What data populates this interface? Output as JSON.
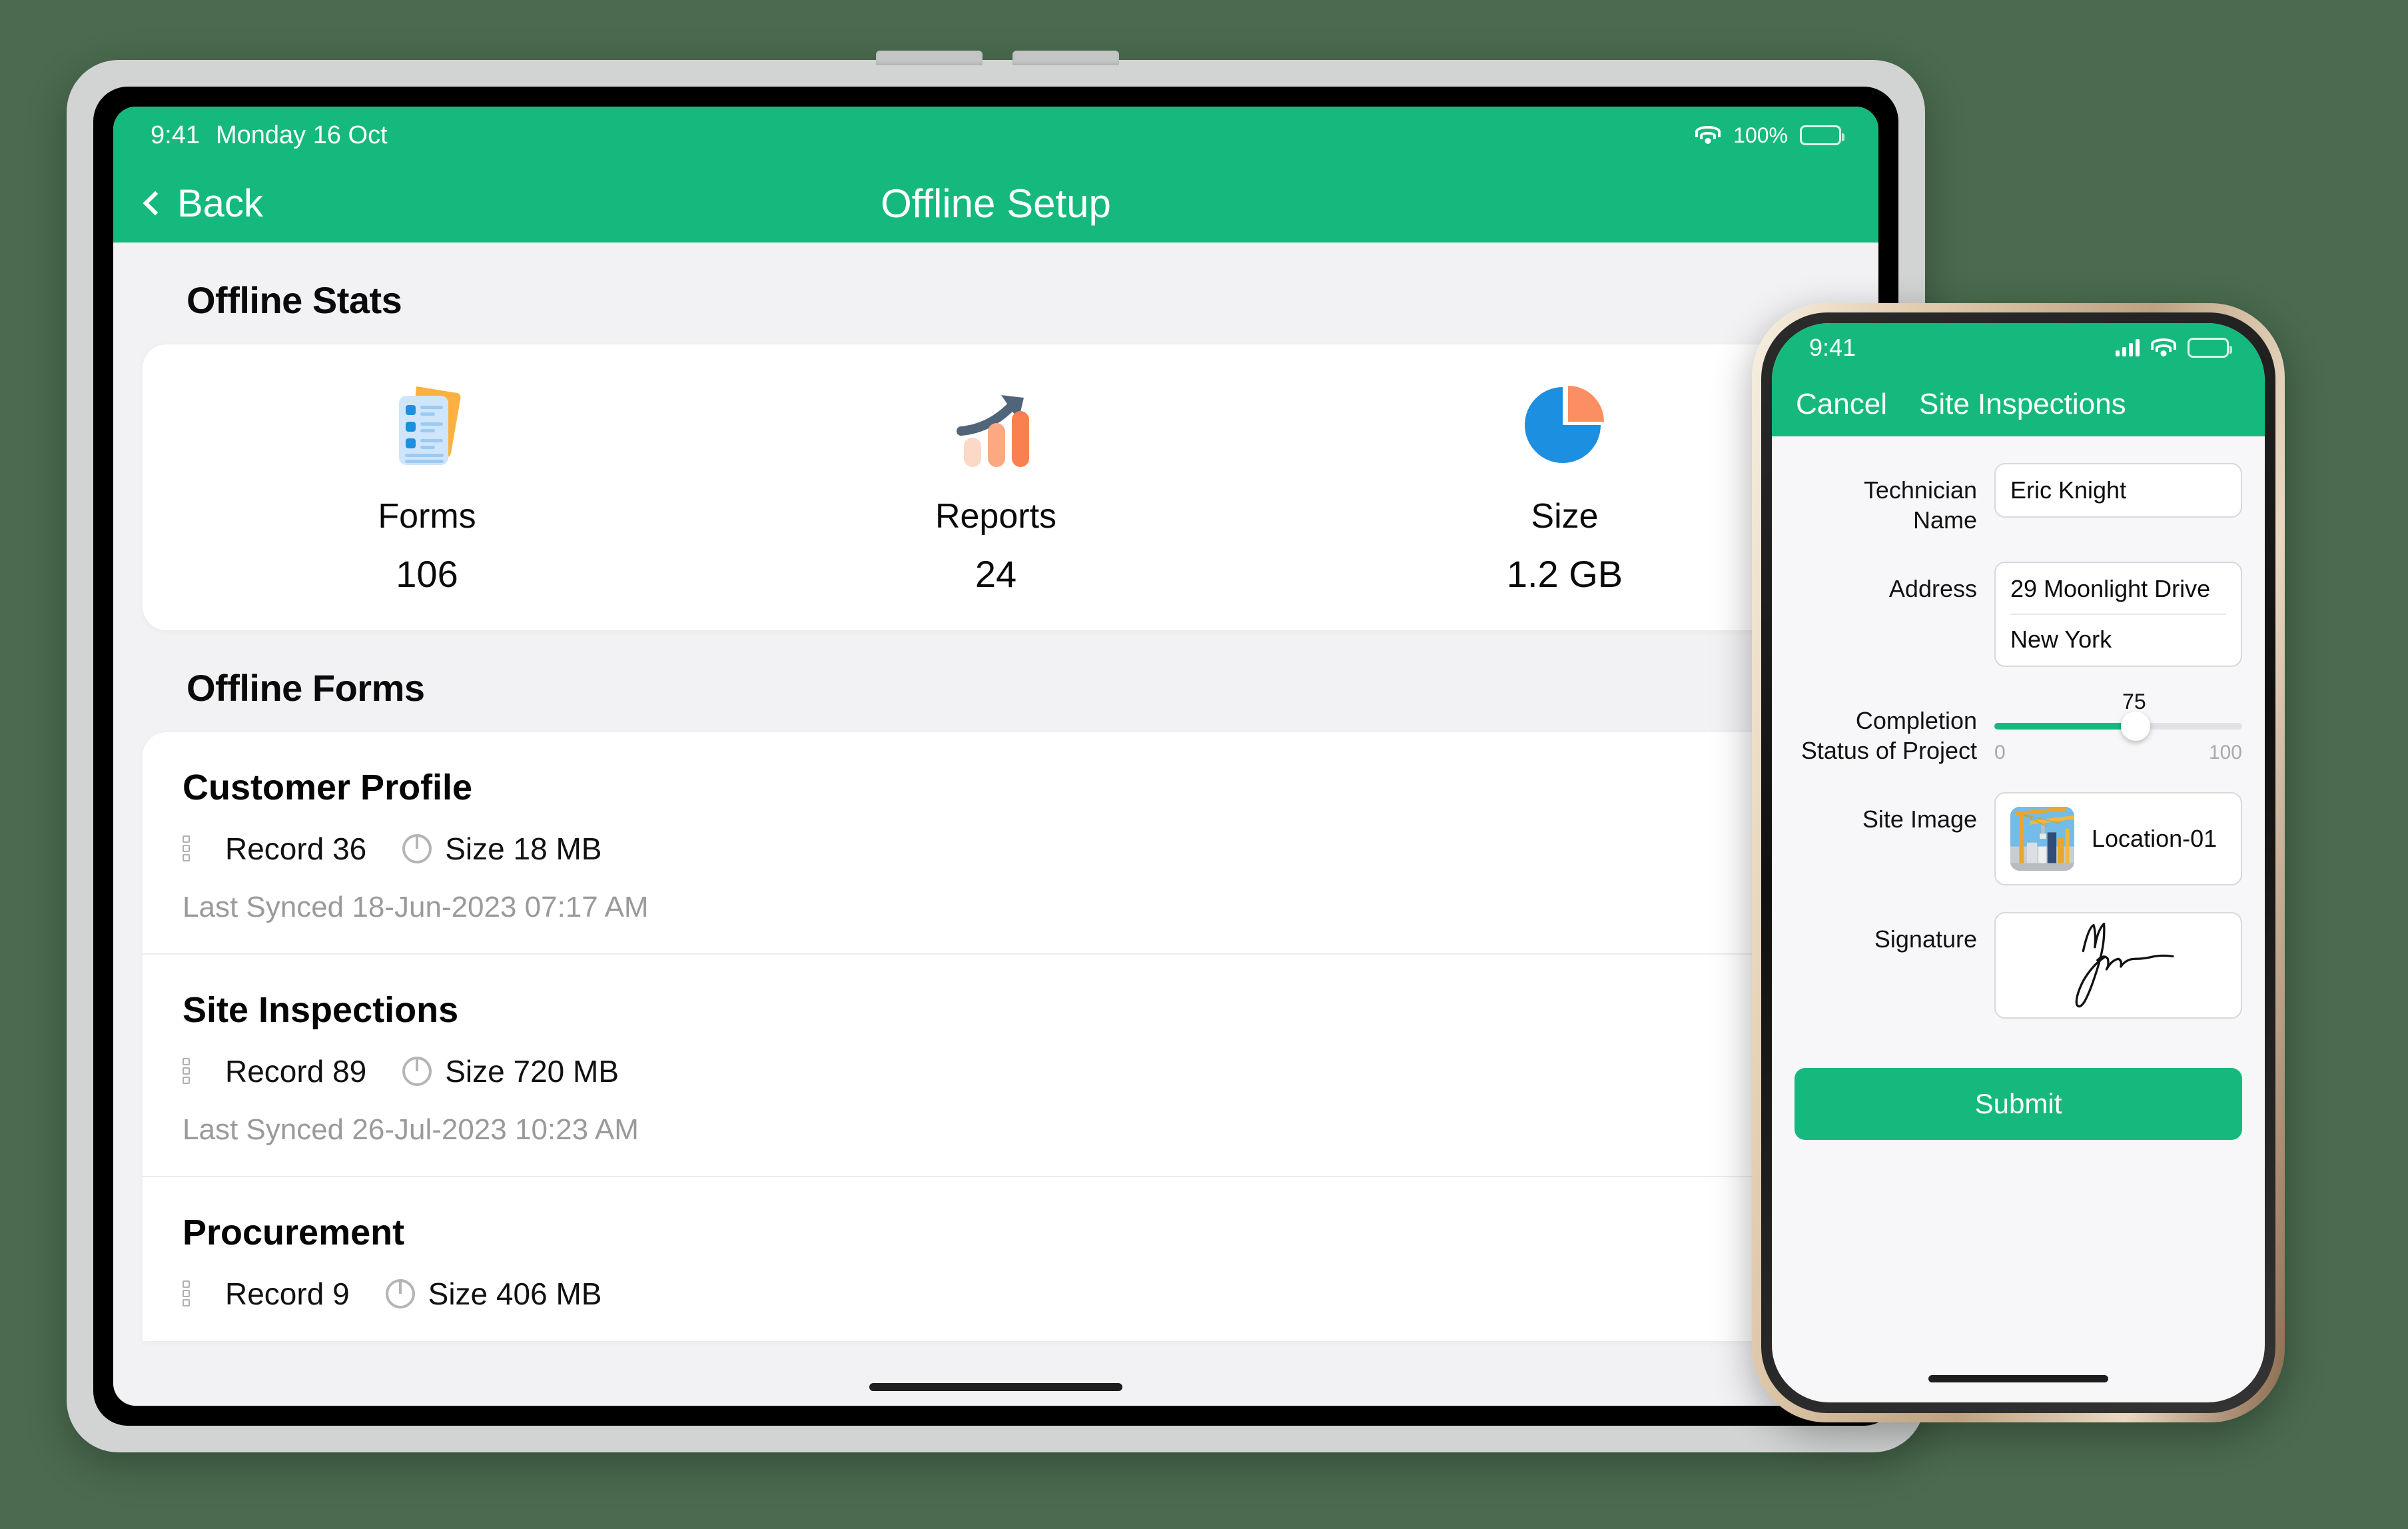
{
  "tablet": {
    "status_bar": {
      "time": "9:41",
      "date": "Monday 16 Oct",
      "battery_percent": "100%",
      "wifi_icon": "wifi-icon",
      "battery_icon": "battery-icon"
    },
    "nav": {
      "back_label": "Back",
      "back_icon": "chevron-left-icon",
      "title": "Offline Setup"
    },
    "stats": {
      "section_title": "Offline Stats",
      "items": [
        {
          "icon": "documents-icon",
          "label": "Forms",
          "value": "106"
        },
        {
          "icon": "bar-chart-growth-icon",
          "label": "Reports",
          "value": "24"
        },
        {
          "icon": "pie-chart-icon",
          "label": "Size",
          "value": "1.2 GB"
        }
      ]
    },
    "forms": {
      "section_title": "Offline Forms",
      "record_icon": "checklist-icon",
      "size_icon": "pie-chart-outline-icon",
      "status_icon": "check-circle-icon",
      "rows": [
        {
          "title": "Customer Profile",
          "record": "Record 36",
          "size": "Size 18 MB",
          "synced": "Last Synced 18-Jun-2023 07:17 AM",
          "synced_status": "synced"
        },
        {
          "title": "Site Inspections",
          "record": "Record 89",
          "size": "Size 720 MB",
          "synced": "Last Synced 26-Jul-2023 10:23 AM",
          "synced_status": "synced"
        },
        {
          "title": "Procurement",
          "record": "Record 9",
          "size": "Size 406 MB",
          "synced": "",
          "synced_status": "synced"
        }
      ]
    }
  },
  "phone": {
    "status_bar": {
      "time": "9:41",
      "signal_icon": "cellular-signal-icon",
      "wifi_icon": "wifi-icon",
      "battery_icon": "battery-icon"
    },
    "nav": {
      "cancel_label": "Cancel",
      "title": "Site Inspections"
    },
    "fields": {
      "technician": {
        "label": "Technician Name",
        "value": "Eric Knight"
      },
      "address": {
        "label": "Address",
        "line1": "29 Moonlight Drive",
        "line2": "New York"
      },
      "completion": {
        "label": "Completion\nStatus of Project",
        "label_line1": "Completion",
        "label_line2": "Status of Project",
        "value": "75",
        "min": "0",
        "max": "100"
      },
      "site_image": {
        "label": "Site Image",
        "thumb_icon": "construction-site-photo",
        "value": "Location-01"
      },
      "signature": {
        "label": "Signature",
        "value": "signature-stroke"
      }
    },
    "submit_label": "Submit"
  },
  "colors": {
    "brand_green": "#16b97d",
    "page_bg": "#4a6b4f",
    "blue": "#1d8fe0",
    "orange": "#f98d63"
  }
}
